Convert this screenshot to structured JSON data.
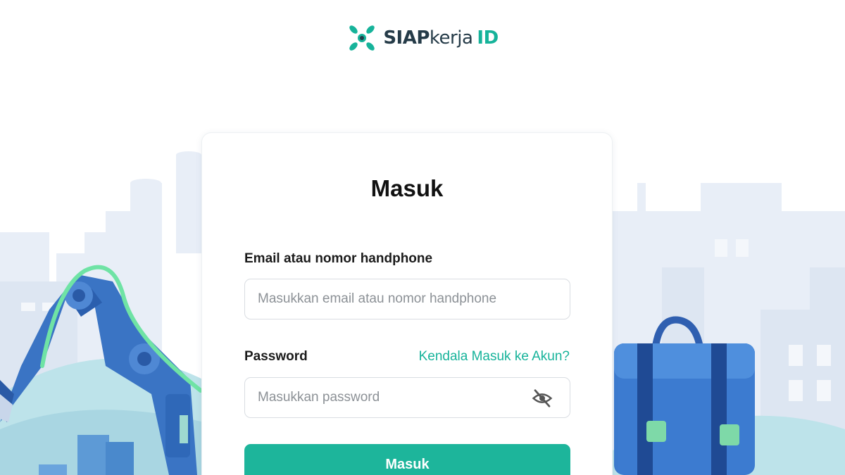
{
  "brand": {
    "name_part1": "SIAP",
    "name_part2": "kerja",
    "name_part3": "ID",
    "primary_color": "#16b39a",
    "dark_color": "#253b48"
  },
  "login": {
    "title": "Masuk",
    "email_label": "Email atau nomor handphone",
    "email_placeholder": "Masukkan email atau nomor handphone",
    "email_value": "",
    "password_label": "Password",
    "password_placeholder": "Masukkan password",
    "password_value": "",
    "help_link": "Kendala Masuk ke Akun?",
    "password_toggle_icon": "eye-off-icon",
    "submit_label": "Masuk"
  },
  "illustration": {
    "left": "robot-arm-illustration",
    "right": "briefcase-illustration",
    "background": "city-skyline-illustration"
  }
}
